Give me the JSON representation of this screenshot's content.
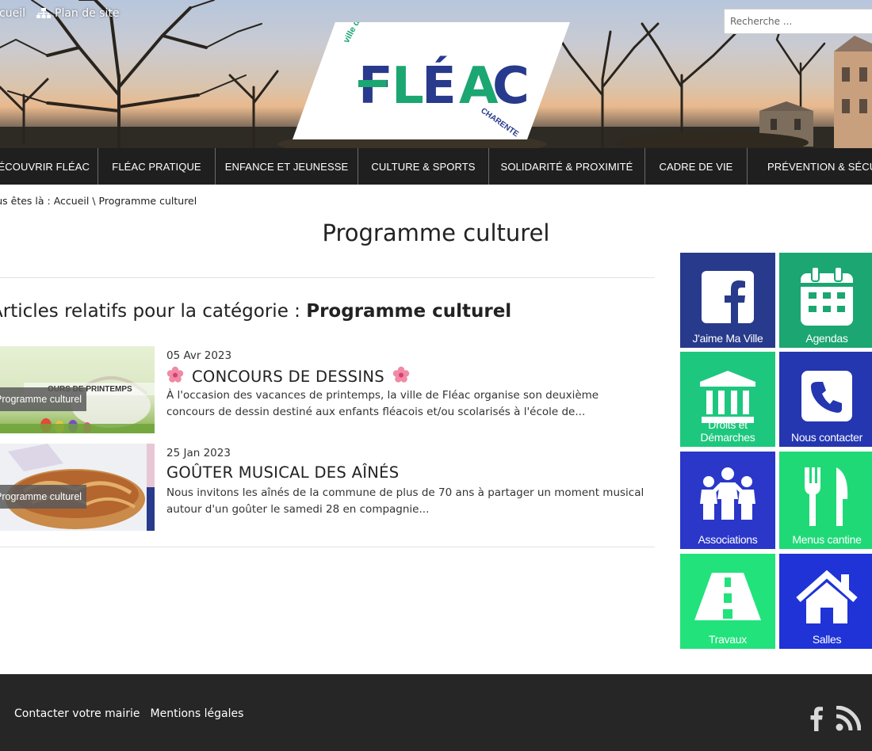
{
  "header": {
    "top_links": [
      {
        "label": "Accueil",
        "icon": "home-link"
      },
      {
        "label": "Plan de site",
        "icon": "sitemap-icon"
      }
    ],
    "search_placeholder": "Recherche ...",
    "logo": {
      "line_top": "ville de",
      "name": "FLÉAC",
      "line_bottom": "CHARENTE"
    }
  },
  "nav": {
    "items": [
      "DÉCOUVRIR FLÉAC",
      "FLÉAC PRATIQUE",
      "ENFANCE ET JEUNESSE",
      "CULTURE & SPORTS",
      "SOLIDARITÉ & PROXIMITÉ",
      "CADRE DE VIE",
      "PRÉVENTION & SÉCURITÉ"
    ]
  },
  "breadcrumb": {
    "prefix": "Vous êtes là : ",
    "home": "Accueil",
    "separator": " \\ ",
    "current": "Programme culturel"
  },
  "page_title": "Programme culturel",
  "category_heading": {
    "prefix": "Articles relatifs pour la catégorie : ",
    "name": "Programme culturel"
  },
  "articles": [
    {
      "tag": "Programme culturel",
      "date": "05 Avr 2023",
      "title": "CONCOURS DE DESSINS",
      "thumb_caption": "OURS DE PRINTEMPS",
      "excerpt": "À l'occasion des vacances de printemps, la ville de Fléac organise son deuxième concours de dessin destiné aux enfants fléacois et/ou scolarisés à l'école de..."
    },
    {
      "tag": "Programme culturel",
      "date": "25 Jan 2023",
      "title": "GOÛTER MUSICAL DES AÎNÉS",
      "excerpt": "Nous invitons les aînés de la commune de plus de 70 ans à partager un moment musical autour d'un goûter le samedi 28 en compagnie..."
    }
  ],
  "tiles": [
    {
      "label": "J'aime Ma Ville",
      "icon": "facebook-icon",
      "color": "#283a8c"
    },
    {
      "label": "Agendas",
      "icon": "calendar-icon",
      "color": "#1ba672"
    },
    {
      "label": "Droits et Démarches",
      "icon": "courthouse-icon",
      "color": "#1ec77e"
    },
    {
      "label": "Nous contacter",
      "icon": "phone-icon",
      "color": "#2436b0"
    },
    {
      "label": "Associations",
      "icon": "people-icon",
      "color": "#2a37c9"
    },
    {
      "label": "Menus cantine",
      "icon": "fork-knife-icon",
      "color": "#1fd977"
    },
    {
      "label": "Travaux",
      "icon": "road-icon",
      "color": "#22e27c"
    },
    {
      "label": "Salles",
      "icon": "house-icon",
      "color": "#1f33d6"
    }
  ],
  "footer": {
    "links": [
      "Contacter votre mairie",
      "Mentions légales"
    ],
    "social": [
      "facebook-icon",
      "rss-icon"
    ]
  }
}
